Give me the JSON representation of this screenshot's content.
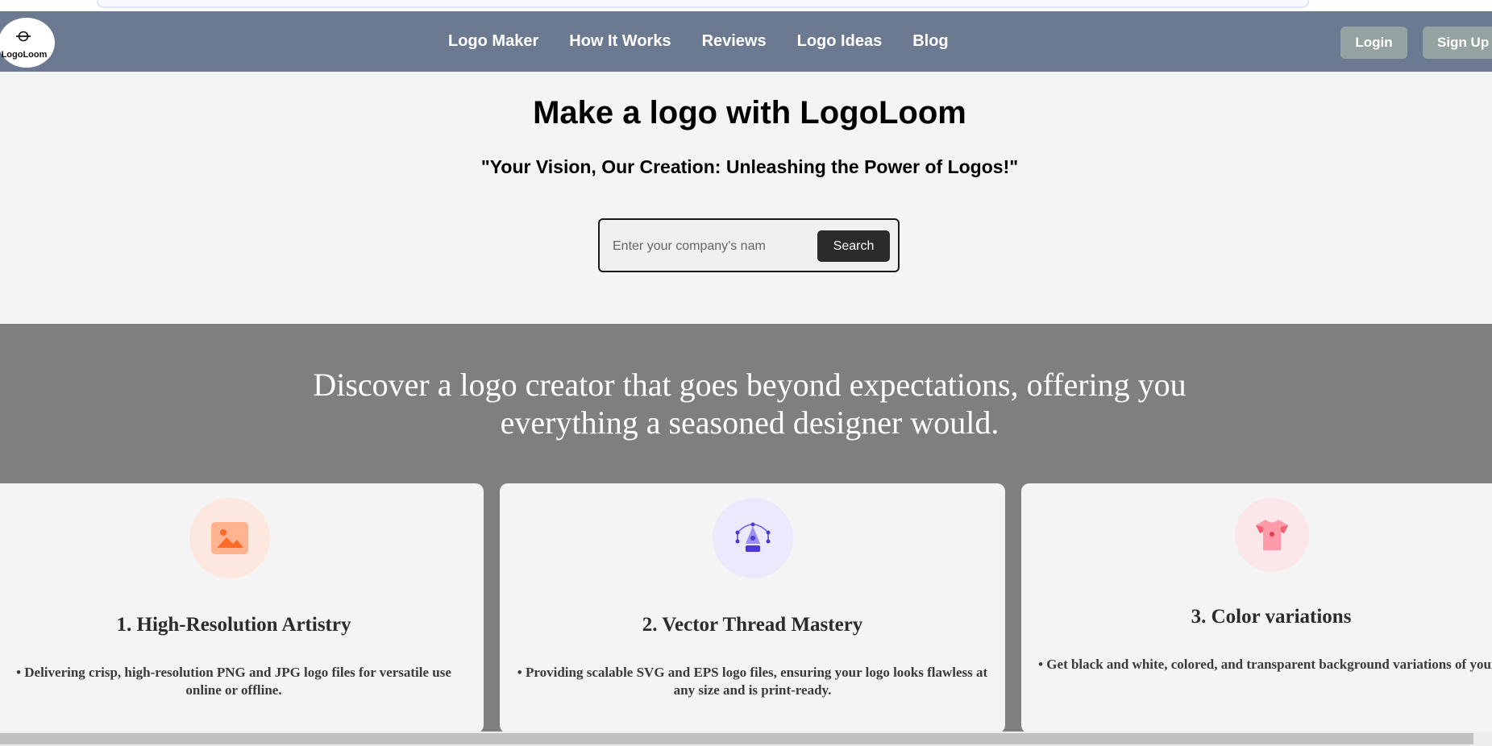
{
  "brand": {
    "logo_text": "LogoLoom"
  },
  "nav": {
    "links": [
      "Logo Maker",
      "How It Works",
      "Reviews",
      "Logo Ideas",
      "Blog"
    ],
    "login_label": "Login",
    "signup_label": "Sign Up"
  },
  "hero": {
    "title": "Make a logo with LogoLoom",
    "subtitle": "\"Your Vision, Our Creation: Unleashing the Power of Logos!\"",
    "search": {
      "placeholder": "Enter your company's name",
      "value": "",
      "button_label": "Search"
    }
  },
  "discover": {
    "text": "Discover a logo creator that goes beyond expectations, offering you everything a seasoned designer would."
  },
  "features": [
    {
      "icon": "image-icon",
      "title": "1. High-Resolution Artistry",
      "desc": "• Delivering crisp, high-resolution PNG and JPG logo files for versatile use online or offline."
    },
    {
      "icon": "pen-tool-icon",
      "title": "2. Vector Thread Mastery",
      "desc": "• Providing scalable SVG and EPS logo files, ensuring your logo looks flawless at any size and is print-ready."
    },
    {
      "icon": "tshirt-icon",
      "title": "3. Color variations",
      "desc": "• Get black and white, colored, and transparent background variations of your logo."
    }
  ],
  "colors": {
    "navbar": "#6b7a91",
    "nav_buttons": "#95a2a2",
    "band": "#7f7f7f",
    "page": "#f4f4f4",
    "search_button": "#2b2b2b"
  }
}
